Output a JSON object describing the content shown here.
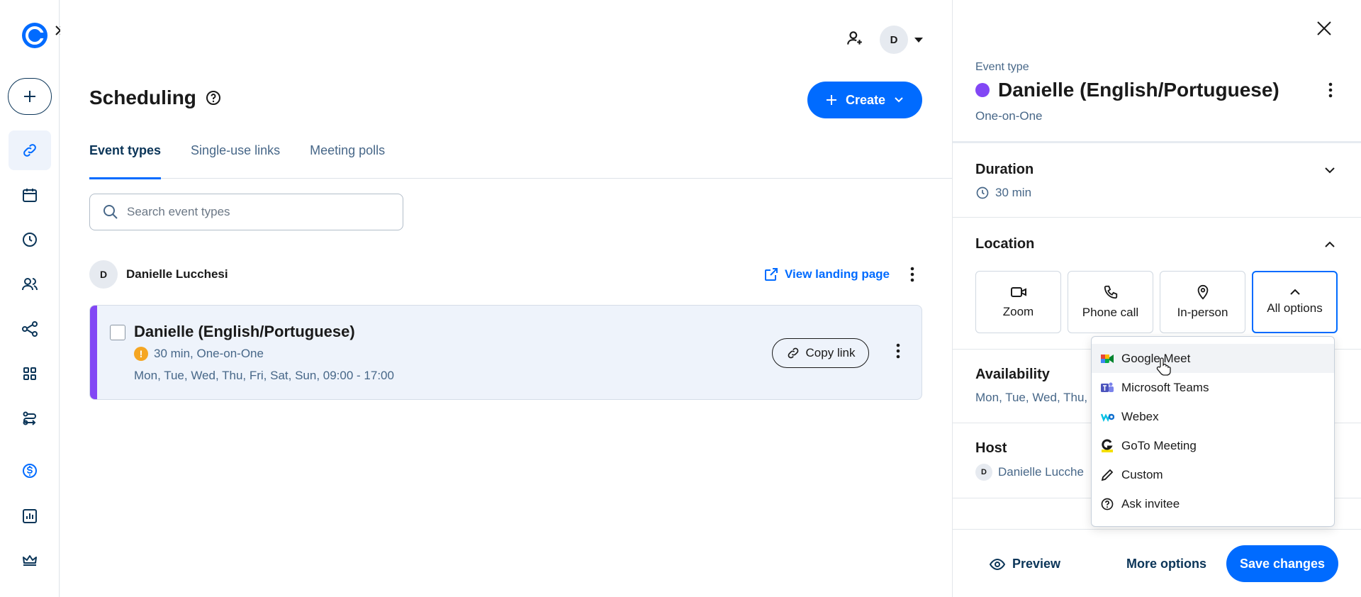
{
  "colors": {
    "accent": "#006bff",
    "event_color": "#8247f5",
    "warning": "#f5a623",
    "navy": "#0b3558"
  },
  "rail": {
    "items": [
      {
        "name": "link-icon",
        "active": true
      },
      {
        "name": "calendar-icon"
      },
      {
        "name": "clock-icon"
      },
      {
        "name": "people-icon"
      },
      {
        "name": "workflow-icon"
      },
      {
        "name": "apps-icon"
      },
      {
        "name": "routing-icon"
      },
      {
        "name": "dollar-icon"
      },
      {
        "name": "analytics-icon"
      },
      {
        "name": "crown-icon"
      }
    ]
  },
  "header": {
    "avatar_initial": "D"
  },
  "main": {
    "title": "Scheduling",
    "create_label": "Create",
    "tabs": [
      {
        "label": "Event types",
        "active": true
      },
      {
        "label": "Single-use links"
      },
      {
        "label": "Meeting polls"
      }
    ],
    "search_placeholder": "Search event types",
    "owner": {
      "initial": "D",
      "name": "Danielle Lucchesi",
      "landing_label": "View landing page"
    },
    "event_card": {
      "title": "Danielle (English/Portuguese)",
      "meta": "30 min, One-on-One",
      "days": "Mon, Tue, Wed, Thu, Fri, Sat, Sun, 09:00 - 17:00",
      "copy_label": "Copy link"
    }
  },
  "panel": {
    "event_type_label": "Event type",
    "event_title": "Danielle (English/Portuguese)",
    "event_subtitle": "One-on-One",
    "duration": {
      "heading": "Duration",
      "value": "30 min"
    },
    "location": {
      "heading": "Location",
      "options": [
        {
          "label": "Zoom",
          "icon": "video-icon"
        },
        {
          "label": "Phone call",
          "icon": "phone-icon"
        },
        {
          "label": "In-person",
          "icon": "pin-icon"
        },
        {
          "label": "All options",
          "icon": "chevron-up-icon",
          "selected": true
        }
      ]
    },
    "availability": {
      "heading": "Availability",
      "value": "Mon, Tue, Wed, Thu,"
    },
    "host": {
      "heading": "Host",
      "initial": "D",
      "value": "Danielle Lucche"
    },
    "footer": {
      "preview_label": "Preview",
      "more_label": "More options",
      "save_label": "Save changes"
    }
  },
  "dropdown": {
    "items": [
      {
        "label": "Google Meet",
        "icon": "google-meet-icon",
        "hover": true
      },
      {
        "label": "Microsoft Teams",
        "icon": "teams-icon"
      },
      {
        "label": "Webex",
        "icon": "webex-icon"
      },
      {
        "label": "GoTo Meeting",
        "icon": "goto-icon"
      },
      {
        "label": "Custom",
        "icon": "pencil-icon"
      },
      {
        "label": "Ask invitee",
        "icon": "question-icon"
      }
    ]
  }
}
